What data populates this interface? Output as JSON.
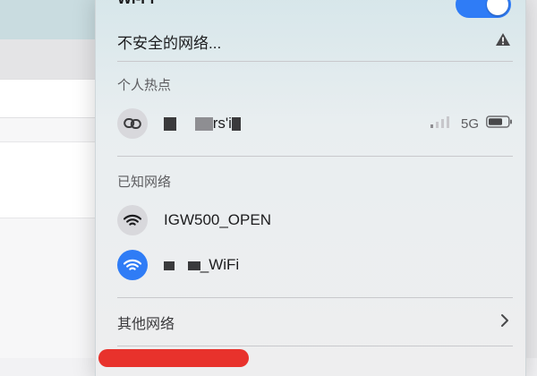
{
  "menu": {
    "title": "Wi-Fi",
    "toggle_on": true,
    "warning_text": "不安全的网络...",
    "hotspot": {
      "section": "个人热点",
      "device_name": "rs'i",
      "band": "5G"
    },
    "known": {
      "section": "已知网络",
      "networks": [
        {
          "name": "IGW500_OPEN",
          "selected": false
        },
        {
          "name": "_WiFi",
          "selected": true
        }
      ]
    },
    "other": {
      "label": "其他网络"
    }
  },
  "colors": {
    "accent": "#2f7cf6",
    "red": "#e8322c"
  }
}
